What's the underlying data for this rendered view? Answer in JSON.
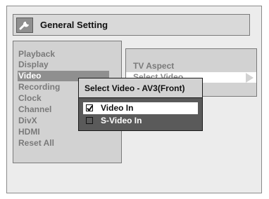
{
  "title": "General Setting",
  "menu": {
    "items": [
      "Playback",
      "Display",
      "Video",
      "Recording",
      "Clock",
      "Channel",
      "DivX",
      "HDMI",
      "Reset All"
    ],
    "selected": "Video"
  },
  "submenu": {
    "items": [
      "TV Aspect",
      "Select Video"
    ],
    "selected": "Select Video"
  },
  "dialog": {
    "title": "Select Video - AV3(Front)",
    "options": [
      {
        "label": "Video In",
        "checked": true
      },
      {
        "label": "S-Video In",
        "checked": false
      }
    ]
  },
  "colors": {
    "panel": "#d2d2d2",
    "dialog_bg": "#5a5a5a",
    "highlight": "#ffffff"
  },
  "icons": {
    "title": "wrench-icon",
    "submenu_arrow": "triangle-right-icon",
    "check": "checkmark-icon"
  }
}
